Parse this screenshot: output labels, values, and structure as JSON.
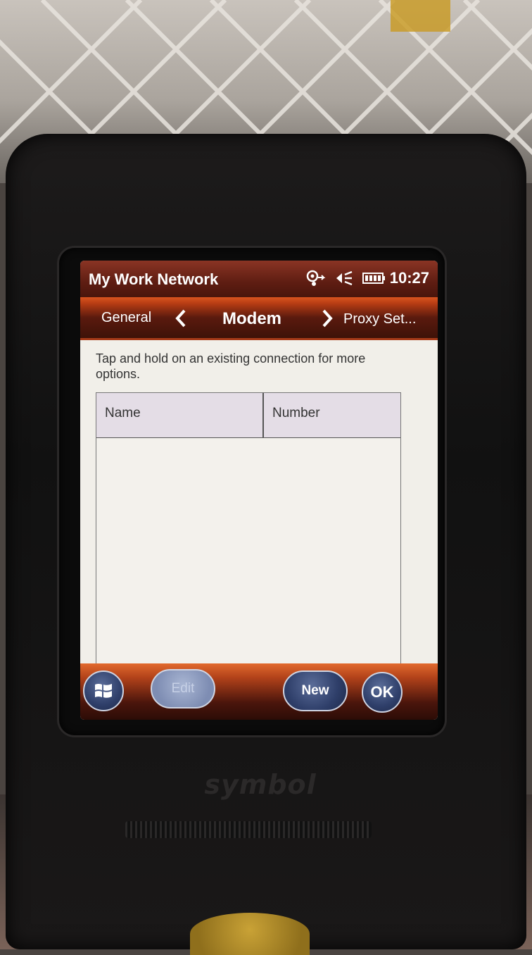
{
  "window": {
    "title": "My Work Network",
    "time": "10:27"
  },
  "status_icons": [
    "network-sync-icon",
    "speaker-muted-icon",
    "battery-icon"
  ],
  "tabs": {
    "previous": "General",
    "current": "Modem",
    "next": "Proxy Set..."
  },
  "content": {
    "hint": "Tap and hold on an existing connection for more options.",
    "columns": [
      "Name",
      "Number"
    ]
  },
  "softkeys": {
    "start_icon": "windows-start-icon",
    "edit": "Edit",
    "new": "New",
    "ok": "OK"
  },
  "device": {
    "brand": "symbol"
  },
  "colors": {
    "titlebar": "#5e1d12",
    "tabbar_accent": "#d9541f",
    "button_blue": "#2f3f6a",
    "header_fill": "#e4dde6"
  }
}
